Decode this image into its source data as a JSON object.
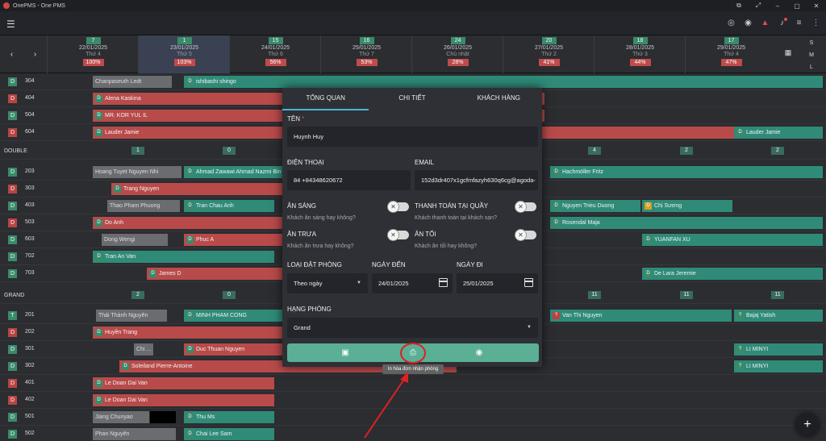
{
  "window": {
    "title": "OnePMS - One PMS"
  },
  "dates": [
    {
      "count": "7",
      "date": "22/01/2025",
      "dow": "Thứ 4",
      "occ": "100%"
    },
    {
      "count": "1",
      "date": "23/01/2025",
      "dow": "Thứ 5",
      "occ": "103%"
    },
    {
      "count": "15",
      "date": "24/01/2025",
      "dow": "Thứ 6",
      "occ": "56%"
    },
    {
      "count": "16",
      "date": "25/01/2025",
      "dow": "Thứ 7",
      "occ": "53%"
    },
    {
      "count": "24",
      "date": "26/01/2025",
      "dow": "Chủ nhật",
      "occ": "28%"
    },
    {
      "count": "20",
      "date": "27/01/2025",
      "dow": "Thứ 2",
      "occ": "41%"
    },
    {
      "count": "18",
      "date": "28/01/2025",
      "dow": "Thứ 3",
      "occ": "44%"
    },
    {
      "count": "17",
      "date": "29/01/2025",
      "dow": "Thứ 4",
      "occ": "47%"
    }
  ],
  "size_options": [
    "S",
    "M",
    "L"
  ],
  "sections": {
    "double": {
      "name": "DOUBLE",
      "avail": [
        "1",
        "0",
        "4",
        "2",
        "2"
      ]
    },
    "grand": {
      "name": "GRAND",
      "avail": [
        "2",
        "0",
        "11",
        "11",
        "11"
      ]
    }
  },
  "rooms": {
    "r304": "304",
    "r404": "404",
    "r504": "504",
    "r604": "604",
    "r203": "203",
    "r303": "303",
    "r403": "403",
    "r503": "503",
    "r603": "603",
    "r702": "702",
    "r703": "703",
    "r201": "201",
    "r202": "202",
    "r301": "301",
    "r302": "302",
    "r401": "401",
    "r402": "402",
    "r501": "501",
    "r502": "502"
  },
  "bookings": {
    "b1": "Chanpaseuth Ledt",
    "b2": "ishibashi shingo",
    "b3": "Alena Kaskina",
    "b4": "MR. KOR YUL IL",
    "b5": "Lauder Jamie",
    "b6": "Lauder Jamie",
    "b7": "Hoang Tuyet Nguyen Nhi",
    "b8": "Ahmad Zawawi Ahmad Nazmi Bin",
    "b9": "Hachmöller Fritz",
    "b10": "Trang Nguyen",
    "b11": "Thao Pham Phuong",
    "b12": "Tran Chau Anh",
    "b13": "Nguyen Trieu Duong",
    "b14": "Chị Sương",
    "b15": "Do Anh",
    "b16": "Rosendal Maja",
    "b17": "Dong Wengi",
    "b18": "Phuc A",
    "b19": "YUANFAN XU",
    "b20": "Tran An Van",
    "b21": "James D",
    "b22": "De Lara Jeremie",
    "b23": "Thái Thành Nguyên",
    "b24": "MINH PHAM CONG",
    "b25": "Van Thi Nguyen",
    "b26": "Bajaj Yatish",
    "b27": "Huyền Trang",
    "b28": "Chi ...",
    "b29": "Duc Thuan Nguyen",
    "b30": "LI MINYI",
    "b31": "Soleiland Pierre-Antoine",
    "b32": "LI MINYI",
    "b33": "Le Doan Dai Van",
    "b34": "Le Doan Dai Van",
    "b35": "Jiang Chunyao",
    "b36": "Thu Ms",
    "b37": "Phan Nguyên",
    "b38": "Chai Lee Sam"
  },
  "modal": {
    "tabs": [
      "TỔNG QUAN",
      "CHI TIẾT",
      "KHÁCH HÀNG"
    ],
    "name_label": "TÊN",
    "name_required": "*",
    "name_value": "Huynh Huy",
    "phone_label": "ĐIỆN THOẠI",
    "phone_value": "84 +84348620672",
    "email_label": "EMAIL",
    "email_value": "152d3dr407x1gcfmfazyh630q6cg@agoda-",
    "breakfast_label": "ĂN SÁNG",
    "breakfast_sub": "Khách ăn sáng hay không?",
    "payment_label": "THANH TOÁN TẠI QUẦY",
    "payment_sub": "Khách thanh toán tại khách sạn?",
    "lunch_label": "ĂN TRƯA",
    "lunch_sub": "Khách ăn trưa hay không?",
    "dinner_label": "ĂN TỐI",
    "dinner_sub": "Khách ăn tối hay không?",
    "booking_type_label": "LOẠI ĐẶT PHÒNG",
    "booking_type_value": "Theo ngày",
    "arrival_label": "NGÀY ĐẾN",
    "arrival_value": "24/01/2025",
    "departure_label": "NGÀY ĐI",
    "departure_value": "25/01/2025",
    "room_class_label": "HẠNG PHÒNG",
    "room_class_value": "Grand"
  },
  "tooltip": "In hóa đơn nhận phòng",
  "colors": {
    "teal": "#2f8b78",
    "red": "#b94a4a",
    "accent": "#5aaf94",
    "annotation": "#e02020"
  }
}
